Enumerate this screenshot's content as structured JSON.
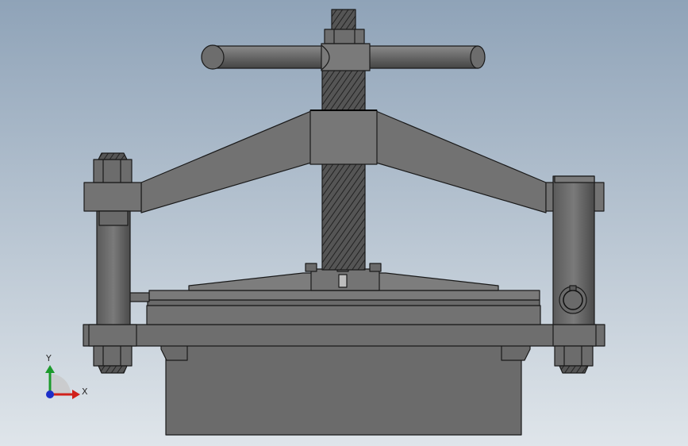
{
  "viewport": {
    "background_top": "#8fa3b8",
    "background_bottom": "#dfe5ea"
  },
  "model": {
    "part_color": "#6e6e6e",
    "edge_color": "#1a1a1a"
  },
  "triad": {
    "x_label": "X",
    "y_label": "Y",
    "x_color": "#d0201a",
    "y_color": "#1c9a2c",
    "z_color": "#1d2fc9"
  }
}
